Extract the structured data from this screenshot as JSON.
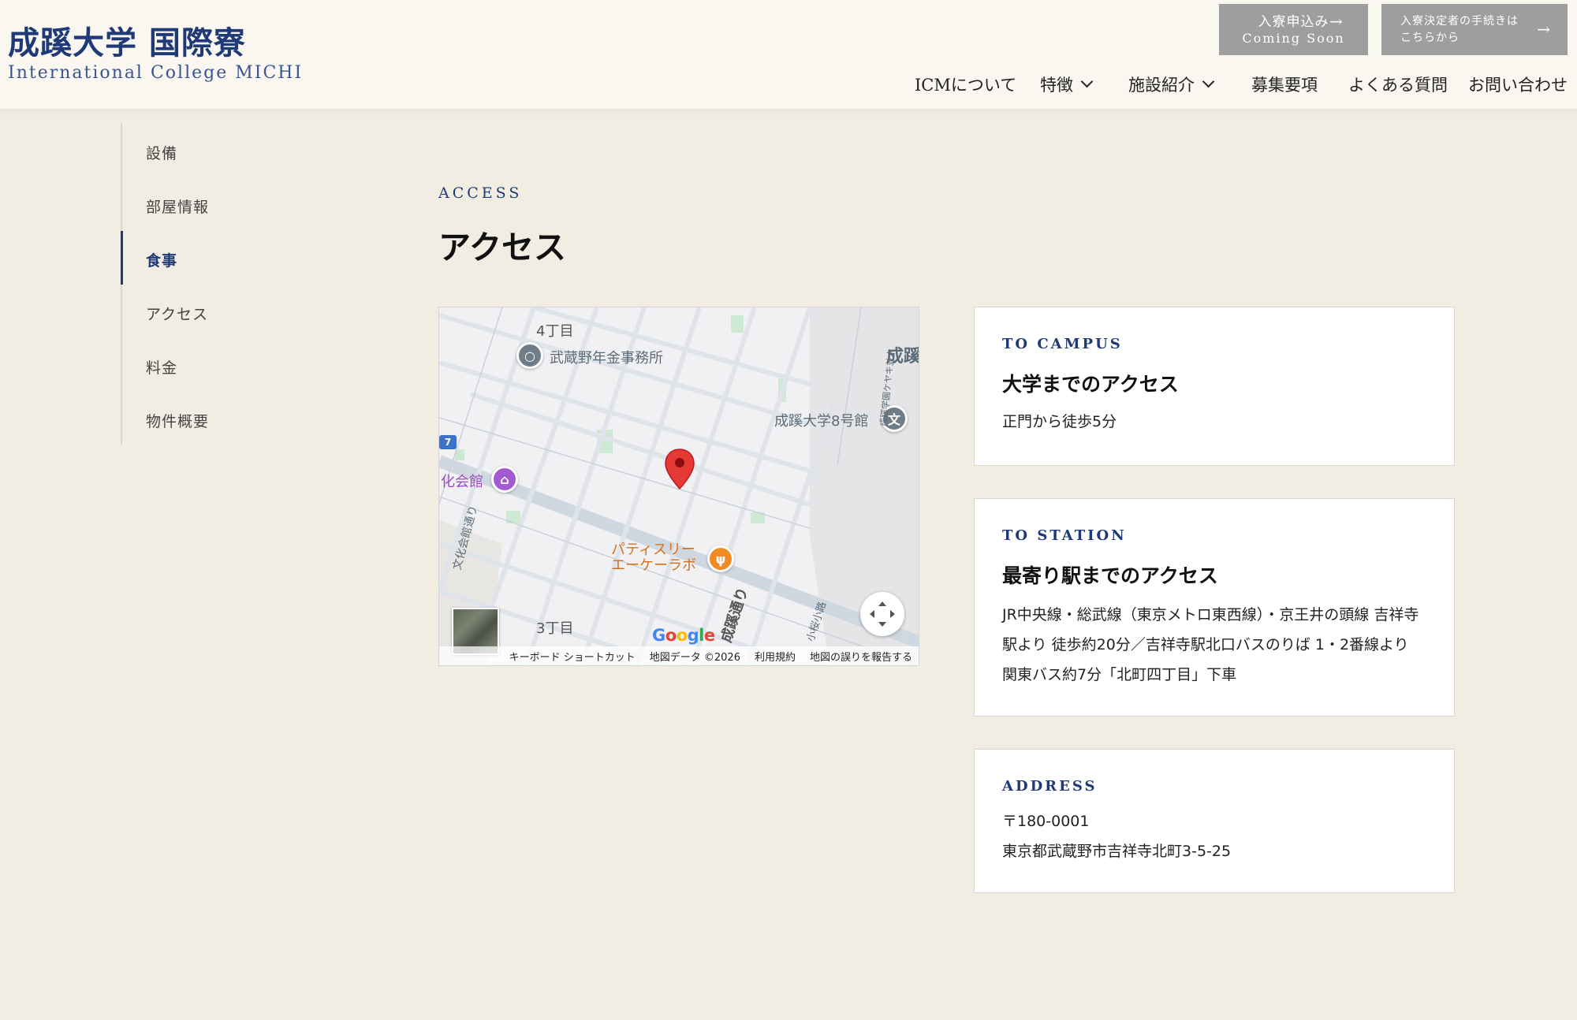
{
  "header": {
    "logo_jp": "成蹊大学 国際寮",
    "logo_en": "International College MICHI",
    "cta_apply": {
      "line1": "入寮申込み",
      "line2": "Coming Soon",
      "arrow": "→"
    },
    "cta_procedure": {
      "line1": "入寮決定者の手続きは",
      "line2": "こちらから",
      "arrow": "→"
    },
    "nav": [
      {
        "label": "ICMについて"
      },
      {
        "label": "特徴"
      },
      {
        "label": "施設紹介"
      },
      {
        "label": "募集要項"
      },
      {
        "label": "よくある質問"
      },
      {
        "label": "お問い合わせ"
      }
    ]
  },
  "sidebar": {
    "active_index": 2,
    "items": [
      {
        "label": "設備"
      },
      {
        "label": "部屋情報"
      },
      {
        "label": "食事"
      },
      {
        "label": "アクセス"
      },
      {
        "label": "料金"
      },
      {
        "label": "物件概要"
      }
    ]
  },
  "main": {
    "eyebrow": "ACCESS",
    "title": "アクセス"
  },
  "map": {
    "labels": {
      "chome4": "4丁目",
      "chome3": "3丁目",
      "pension": "武蔵野年金事務所",
      "seikei8": "成蹊大学8号館",
      "seikei_edge": "成蹊",
      "bunka_hall": "化会館",
      "bunka_street": "文化会館通り",
      "patisserie1": "パティスリー",
      "patisserie2": "エーケーラボ",
      "seikei_street": "成蹊通り",
      "sakura_street": "小桜小路",
      "keyaki_street": "成蹊学園ケヤキ並木",
      "route": "7"
    },
    "poi_icons": {
      "pension": "○",
      "seikei8": "文",
      "hall": "⌂",
      "food": "ψ"
    },
    "google": "Google",
    "google_colors": [
      "#4285F4",
      "#EA4335",
      "#FBBC05",
      "#4285F4",
      "#34A853",
      "#EA4335"
    ],
    "pin_color": "#e53935",
    "attribution": [
      "キーボード ショートカット",
      "地図データ ©2026",
      "利用規約",
      "地図の誤りを報告する"
    ]
  },
  "cards": {
    "campus": {
      "eyebrow": "TO CAMPUS",
      "title": "大学までのアクセス",
      "body": "正門から徒歩5分"
    },
    "station": {
      "eyebrow": "TO STATION",
      "title": "最寄り駅までのアクセス",
      "lines": [
        "JR中央線・総武線（東京メトロ東西線）・京王井の頭線 吉祥寺",
        "駅より 徒歩約20分／吉祥寺駅北口バスのりば 1・2番線より",
        "関東バス約7分「北町四丁目」下車"
      ]
    },
    "address": {
      "eyebrow": "ADDRESS",
      "postal": "〒180-0001",
      "street": "東京都武蔵野市吉祥寺北町3-5-25"
    }
  },
  "colors": {
    "brand_navy": "#1f3a77",
    "background": "#f2ede3",
    "header_bg": "#faf7f1",
    "cta_gray": "#9e9e9e"
  }
}
